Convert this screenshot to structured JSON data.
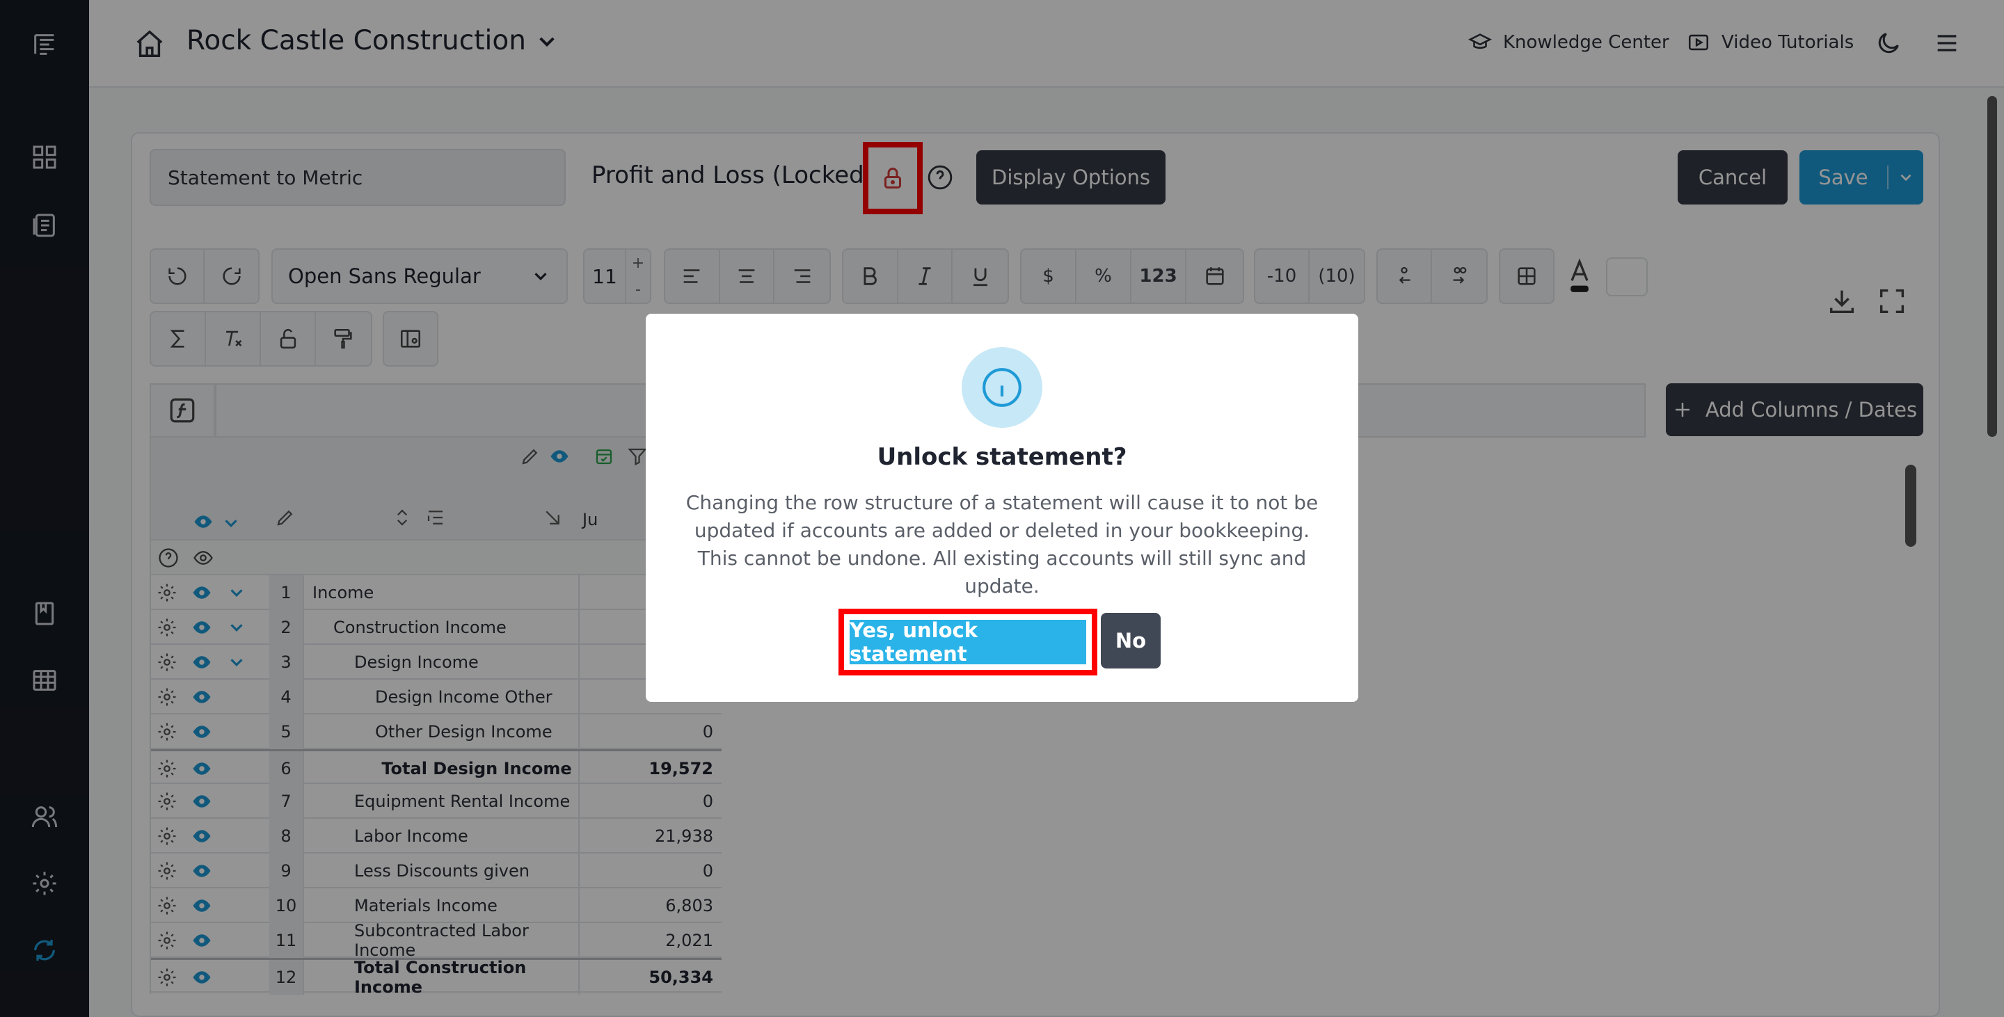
{
  "header": {
    "company": "Rock Castle Construction",
    "knowledge_center": "Knowledge Center",
    "video_tutorials": "Video Tutorials"
  },
  "statement": {
    "name_value": "Statement to Metric",
    "title": "Profit and Loss (Locked)",
    "display_options": "Display Options",
    "cancel": "Cancel",
    "save": "Save"
  },
  "toolbar": {
    "font": "Open Sans Regular",
    "size": "11",
    "size_up": "+",
    "size_down": "-",
    "dollar": "$",
    "percent": "%",
    "number": "123",
    "neg_minus": "-10",
    "neg_paren": "(10)",
    "add_columns": "Add Columns / Dates"
  },
  "grid": {
    "column_header_partial": "Ju",
    "rows": [
      {
        "num": "1",
        "name": "Income",
        "value": "",
        "indent": 0,
        "total": false
      },
      {
        "num": "2",
        "name": "Construction Income",
        "value": "",
        "indent": 1,
        "total": false
      },
      {
        "num": "3",
        "name": "Design Income",
        "value": "",
        "indent": 2,
        "total": false
      },
      {
        "num": "4",
        "name": "Design Income Other",
        "value": "",
        "indent": 3,
        "total": false
      },
      {
        "num": "5",
        "name": "Other Design Income",
        "value": "0",
        "indent": 3,
        "total": false
      },
      {
        "num": "6",
        "name": "Total Design Income",
        "value": "19,572",
        "indent": 3,
        "total": true
      },
      {
        "num": "7",
        "name": "Equipment Rental Income",
        "value": "0",
        "indent": 2,
        "total": false
      },
      {
        "num": "8",
        "name": "Labor Income",
        "value": "21,938",
        "indent": 2,
        "total": false
      },
      {
        "num": "9",
        "name": "Less Discounts given",
        "value": "0",
        "indent": 2,
        "total": false
      },
      {
        "num": "10",
        "name": "Materials Income",
        "value": "6,803",
        "indent": 2,
        "total": false
      },
      {
        "num": "11",
        "name": "Subcontracted Labor Income",
        "value": "2,021",
        "indent": 2,
        "total": false
      },
      {
        "num": "12",
        "name": "Total Construction Income",
        "value": "50,334",
        "indent": 2,
        "total": true
      }
    ]
  },
  "modal": {
    "title": "Unlock statement?",
    "body": "Changing the row structure of a statement will cause it to not be updated if accounts are added or deleted in your bookkeeping. This cannot be undone. All existing accounts will still sync and update.",
    "yes": "Yes, unlock statement",
    "no": "No"
  },
  "colors": {
    "accent": "#1e9ad6",
    "highlight": "#ff0000",
    "dark_button": "#353a44",
    "rail": "#161a22"
  }
}
